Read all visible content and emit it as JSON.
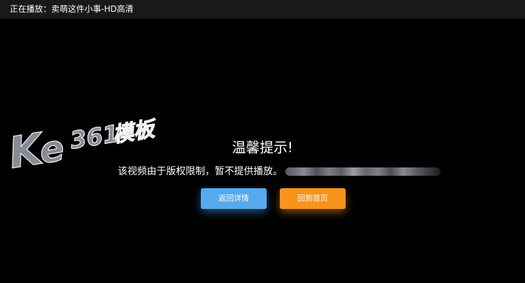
{
  "header": {
    "now_playing": "正在播放：卖萌这件小事-HD高清"
  },
  "watermark": {
    "logo_text": "Ke 361模板"
  },
  "notice": {
    "title": "温馨提示!",
    "message": "该视频由于版权限制，暂不提供播放。"
  },
  "buttons": {
    "back_label": "返回详情",
    "home_label": "回到首页"
  },
  "colors": {
    "background": "#000000",
    "topbar": "#191919",
    "back_button": "#55aaee",
    "home_button": "#f7941d",
    "text": "#ffffff"
  }
}
